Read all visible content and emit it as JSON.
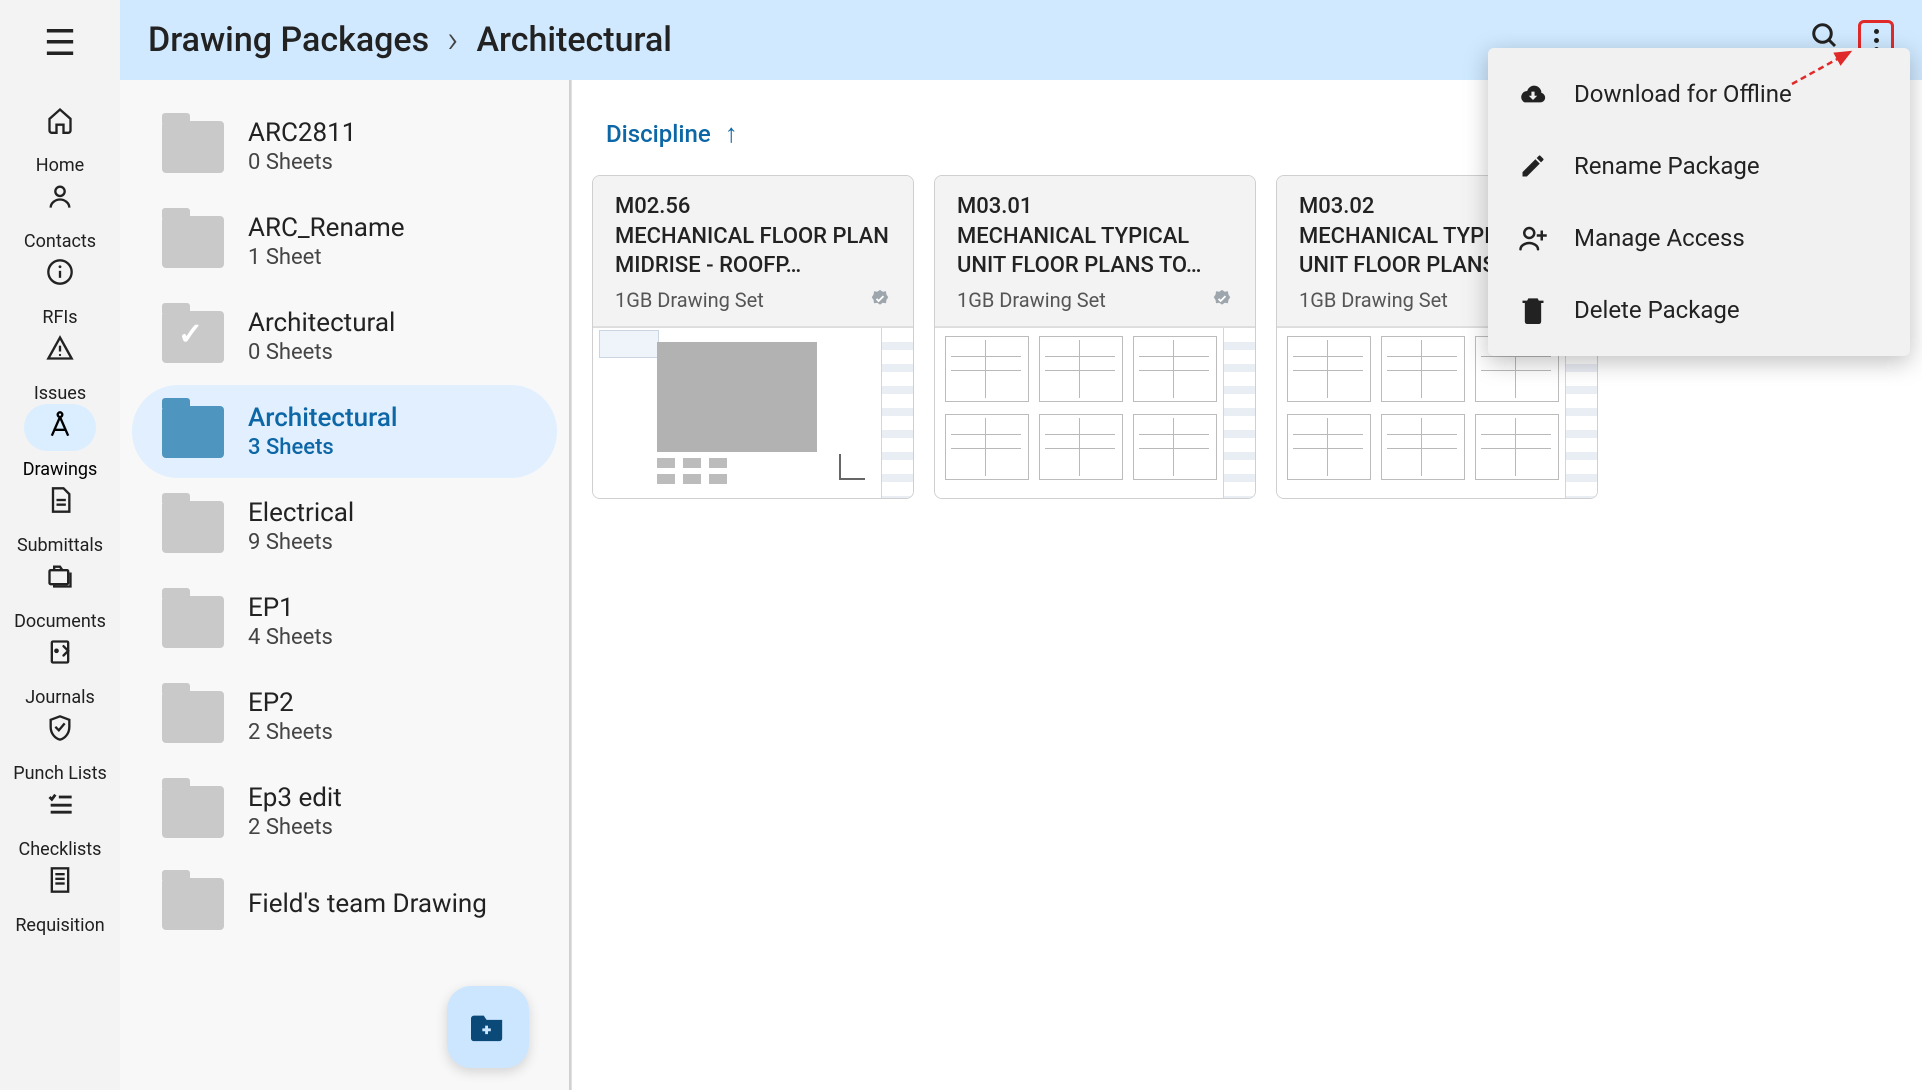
{
  "sidebar": {
    "items": [
      {
        "icon": "home",
        "label": "Home"
      },
      {
        "icon": "person",
        "label": "Contacts"
      },
      {
        "icon": "info",
        "label": "RFIs"
      },
      {
        "icon": "warning",
        "label": "Issues"
      },
      {
        "icon": "compass",
        "label": "Drawings"
      },
      {
        "icon": "note",
        "label": "Submittals"
      },
      {
        "icon": "folders",
        "label": "Documents"
      },
      {
        "icon": "journal",
        "label": "Journals"
      },
      {
        "icon": "shield",
        "label": "Punch Lists"
      },
      {
        "icon": "checklist",
        "label": "Checklists"
      },
      {
        "icon": "receipt",
        "label": "Requisition"
      }
    ]
  },
  "breadcrumb": {
    "root": "Drawing Packages",
    "current": "Architectural"
  },
  "folders": [
    {
      "name": "ARC2811",
      "count": "0 Sheets",
      "variant": "default"
    },
    {
      "name": "ARC_Rename",
      "count": "1 Sheet",
      "variant": "default"
    },
    {
      "name": "Architectural",
      "count": "0 Sheets",
      "variant": "check"
    },
    {
      "name": "Architectural",
      "count": "3 Sheets",
      "variant": "selected"
    },
    {
      "name": "Electrical",
      "count": "9 Sheets",
      "variant": "default"
    },
    {
      "name": "EP1",
      "count": "4 Sheets",
      "variant": "default"
    },
    {
      "name": "EP2",
      "count": "2 Sheets",
      "variant": "default"
    },
    {
      "name": "Ep3 edit",
      "count": "2 Sheets",
      "variant": "default"
    },
    {
      "name": "Field's team Drawing",
      "count": "",
      "variant": "default"
    }
  ],
  "sort": {
    "label": "Discipline",
    "direction": "asc"
  },
  "cards": [
    {
      "code": "M02.56",
      "title": "MECHANICAL FLOOR PLAN MIDRISE - ROOFP…",
      "set": "1GB Drawing Set",
      "verified": true
    },
    {
      "code": "M03.01",
      "title": "MECHANICAL TYPICAL UNIT FLOOR PLANS TO…",
      "set": "1GB Drawing Set",
      "verified": true
    },
    {
      "code": "M03.02",
      "title": "MECHANICAL TYPICAL UNIT FLOOR PLANS",
      "set": "1GB Drawing Set",
      "verified": false
    }
  ],
  "menu": {
    "download": "Download for Offline",
    "rename": "Rename Package",
    "manage": "Manage Access",
    "delete": "Delete Package"
  }
}
